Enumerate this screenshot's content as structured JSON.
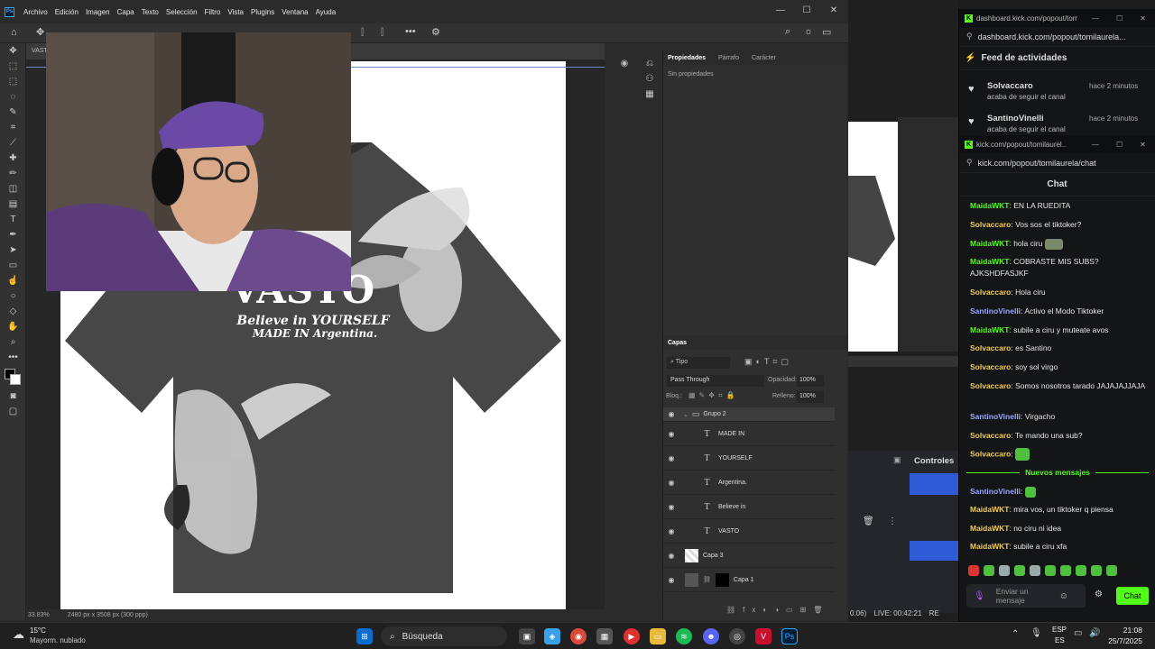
{
  "photoshop": {
    "menu": [
      "Archivo",
      "Edición",
      "Imagen",
      "Capa",
      "Texto",
      "Selección",
      "Filtro",
      "Vista",
      "Plugins",
      "Ventana",
      "Ayuda"
    ],
    "doc_tab": "VASTO",
    "zoom": "33.83%",
    "doc_info": "2480 px x 3508 px (300 ppp)",
    "design_text": {
      "line1": "VASTO",
      "line2": "Believe in YOURSELF",
      "line3": "MADE IN Argentina."
    },
    "properties_panel": {
      "tabs": [
        "Propiedades",
        "Párrafo",
        "Carácter"
      ],
      "empty_text": "Sin propiedades"
    },
    "layers_panel": {
      "title": "Capas",
      "filter_label": "Tipo",
      "blend_mode": "Pass Through",
      "opacity_label": "Opacidad:",
      "opacity_value": "100%",
      "lock_label": "Bloq.:",
      "fill_label": "Relleno:",
      "fill_value": "100%",
      "layers": [
        {
          "name": "Grupo 2",
          "kind": "group"
        },
        {
          "name": "MADE IN",
          "kind": "text"
        },
        {
          "name": "YOURSELF",
          "kind": "text"
        },
        {
          "name": "Argentina.",
          "kind": "text"
        },
        {
          "name": "Believe in",
          "kind": "text"
        },
        {
          "name": "VASTO",
          "kind": "text"
        },
        {
          "name": "Capa 3",
          "kind": "pixel"
        },
        {
          "name": "Capa 1",
          "kind": "masked"
        }
      ]
    }
  },
  "background_window": {
    "controls_label": "Controles",
    "stream_status": "LIVE: 00:42:21",
    "partial_text_1": "0.06)",
    "partial_text_2": "RE"
  },
  "kick_feed": {
    "window_title": "dashboard.kick.com/popout/tomilaurela...",
    "url": "dashboard.kick.com/popout/tomilaurela...",
    "heading": "Feed de actividades",
    "items": [
      {
        "user": "Solvaccaro",
        "action": "acaba de seguir el canal",
        "time": "hace 2 minutos"
      },
      {
        "user": "SantinoVinelli",
        "action": "acaba de seguir el canal",
        "time": "hace 2 minutos"
      }
    ]
  },
  "kick_chat": {
    "window_title": "kick.com/popout/tomilaurel...",
    "url": "kick.com/popout/tomilaurela/chat",
    "heading": "Chat",
    "messages": [
      {
        "user": "MaidaWKT",
        "text": "EN LA RUEDITA",
        "color": "green"
      },
      {
        "user": "Solvaccaro",
        "text": "Vos sos el tiktoker?",
        "color": "yellow"
      },
      {
        "user": "MaidaWKT",
        "text": "hola ciru",
        "color": "green"
      },
      {
        "user": "MaidaWKT",
        "text": "COBRASTE MIS SUBS? AJKSHDFASJKF",
        "color": "green"
      },
      {
        "user": "Solvaccaro",
        "text": "Hola ciru",
        "color": "yellow"
      },
      {
        "user": "SantinoVinelli",
        "text": "Activo el Modo Tiktoker",
        "color": "blue"
      },
      {
        "user": "MaidaWKT",
        "text": "subile a ciru y muteate avos",
        "color": "green"
      },
      {
        "user": "Solvaccaro",
        "text": "es Santino",
        "color": "yellow"
      },
      {
        "user": "Solvaccaro",
        "text": "soy sol virgo",
        "color": "yellow"
      },
      {
        "user": "Solvaccaro",
        "text": "Somos nosotros tarado JAJAJAJJAJA",
        "color": "yellow"
      },
      {
        "user": "SantinoVinelli",
        "text": "Virgacho",
        "color": "blue"
      },
      {
        "user": "Solvaccaro",
        "text": "Te mando una sub?",
        "color": "yellow"
      },
      {
        "user": "Solvaccaro",
        "text": "",
        "color": "yellow"
      }
    ],
    "new_messages_label": "Nuevos mensajes",
    "new_messages": [
      {
        "user": "SantinoVinelli",
        "text": "",
        "color": "blue"
      },
      {
        "user": "MaidaWKT",
        "text": "mira vos, un tiktoker q piensa",
        "color": "green"
      },
      {
        "user": "MaidaWKT",
        "text": "no ciru ni idea",
        "color": "green"
      },
      {
        "user": "MaidaWKT",
        "text": "subile a ciru xfa",
        "color": "green"
      }
    ],
    "input_placeholder": "Enviar un mensaje",
    "send_label": "Chat"
  },
  "taskbar": {
    "weather_temp": "15°C",
    "weather_desc": "Mayorm. nublado",
    "search_label": "Búsqueda",
    "lang_top": "ESP",
    "lang_bottom": "ES",
    "time": "21:08",
    "date": "25/7/2025"
  }
}
